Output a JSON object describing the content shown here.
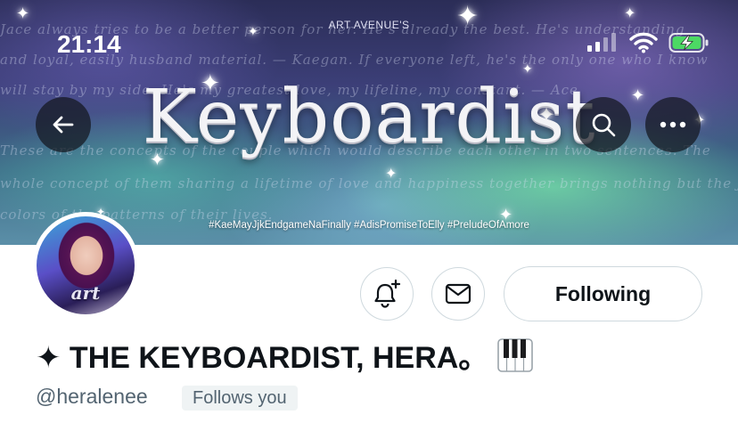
{
  "status_bar": {
    "time": "21:14"
  },
  "banner": {
    "brand": "ART AVENUE'S",
    "title_art": "Keyboardist",
    "hashtags": "#KaeMayJjkEndgameNaFinally #AdisPromiseToElly #PreludeOfAmore",
    "script_lines": [
      "Jace always tries to be a better person for her. He's already the best. He's understanding",
      "and loyal, easily husband material. — Kaegan. If everyone left, he's the only one who I know",
      "will stay by my side. He's my greatest love, my lifeline, my constant. — Ace",
      "These are the concepts of the couple which would describe each other in two sentences. The",
      "whole concept of them sharing a lifetime of love and happiness together brings nothing but the joy and bright",
      "colors of the patterns of their lives."
    ]
  },
  "profile": {
    "avatar_logo": "art",
    "following_label": "Following",
    "display_name": "✦ THE KEYBOARDIST, HERA。",
    "handle": "@heralenee",
    "follows_you": "Follows you"
  },
  "icons": {
    "back": "arrow-left-icon",
    "search": "search-icon",
    "more": "more-icon",
    "notify": "bell-plus-icon",
    "message": "envelope-icon",
    "piano": "piano-icon"
  },
  "colors": {
    "text_primary": "#0f1419",
    "text_secondary": "#536471",
    "border": "#cfd9de",
    "battery_green": "#4cd964",
    "badge_bg": "#eff3f4"
  }
}
